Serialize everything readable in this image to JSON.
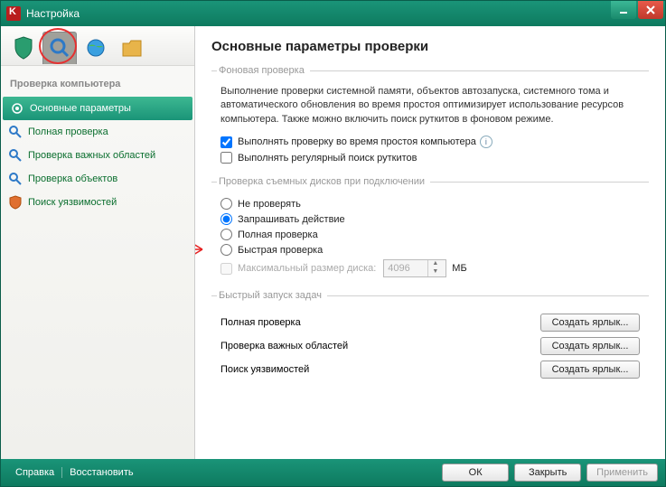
{
  "window": {
    "title": "Настройка"
  },
  "sidebar": {
    "category_title": "Проверка компьютера",
    "items": [
      {
        "label": "Основные параметры"
      },
      {
        "label": "Полная проверка"
      },
      {
        "label": "Проверка важных областей"
      },
      {
        "label": "Проверка объектов"
      },
      {
        "label": "Поиск уязвимостей"
      }
    ]
  },
  "content": {
    "heading": "Основные параметры проверки",
    "group_bg": {
      "legend": "Фоновая проверка",
      "description": "Выполнение проверки системной памяти, объектов автозапуска, системного тома и автоматического обновления во время простоя оптимизирует использование ресурсов компьютера. Также можно включить поиск руткитов в фоновом режиме.",
      "cb_idle": "Выполнять проверку во время простоя компьютера",
      "cb_rootkit": "Выполнять регулярный поиск руткитов"
    },
    "group_removable": {
      "legend": "Проверка съемных дисков при подключении",
      "r_none": "Не проверять",
      "r_ask": "Запрашивать действие",
      "r_full": "Полная проверка",
      "r_quick": "Быстрая проверка",
      "cb_maxsize": "Максимальный размер диска:",
      "size_value": "4096",
      "size_unit": "МБ"
    },
    "group_quick": {
      "legend": "Быстрый запуск задач",
      "rows": [
        {
          "label": "Полная проверка",
          "button": "Создать ярлык..."
        },
        {
          "label": "Проверка важных областей",
          "button": "Создать ярлык..."
        },
        {
          "label": "Поиск уязвимостей",
          "button": "Создать ярлык..."
        }
      ]
    }
  },
  "footer": {
    "help": "Справка",
    "restore": "Восстановить",
    "ok": "ОК",
    "close": "Закрыть",
    "apply": "Применить"
  }
}
